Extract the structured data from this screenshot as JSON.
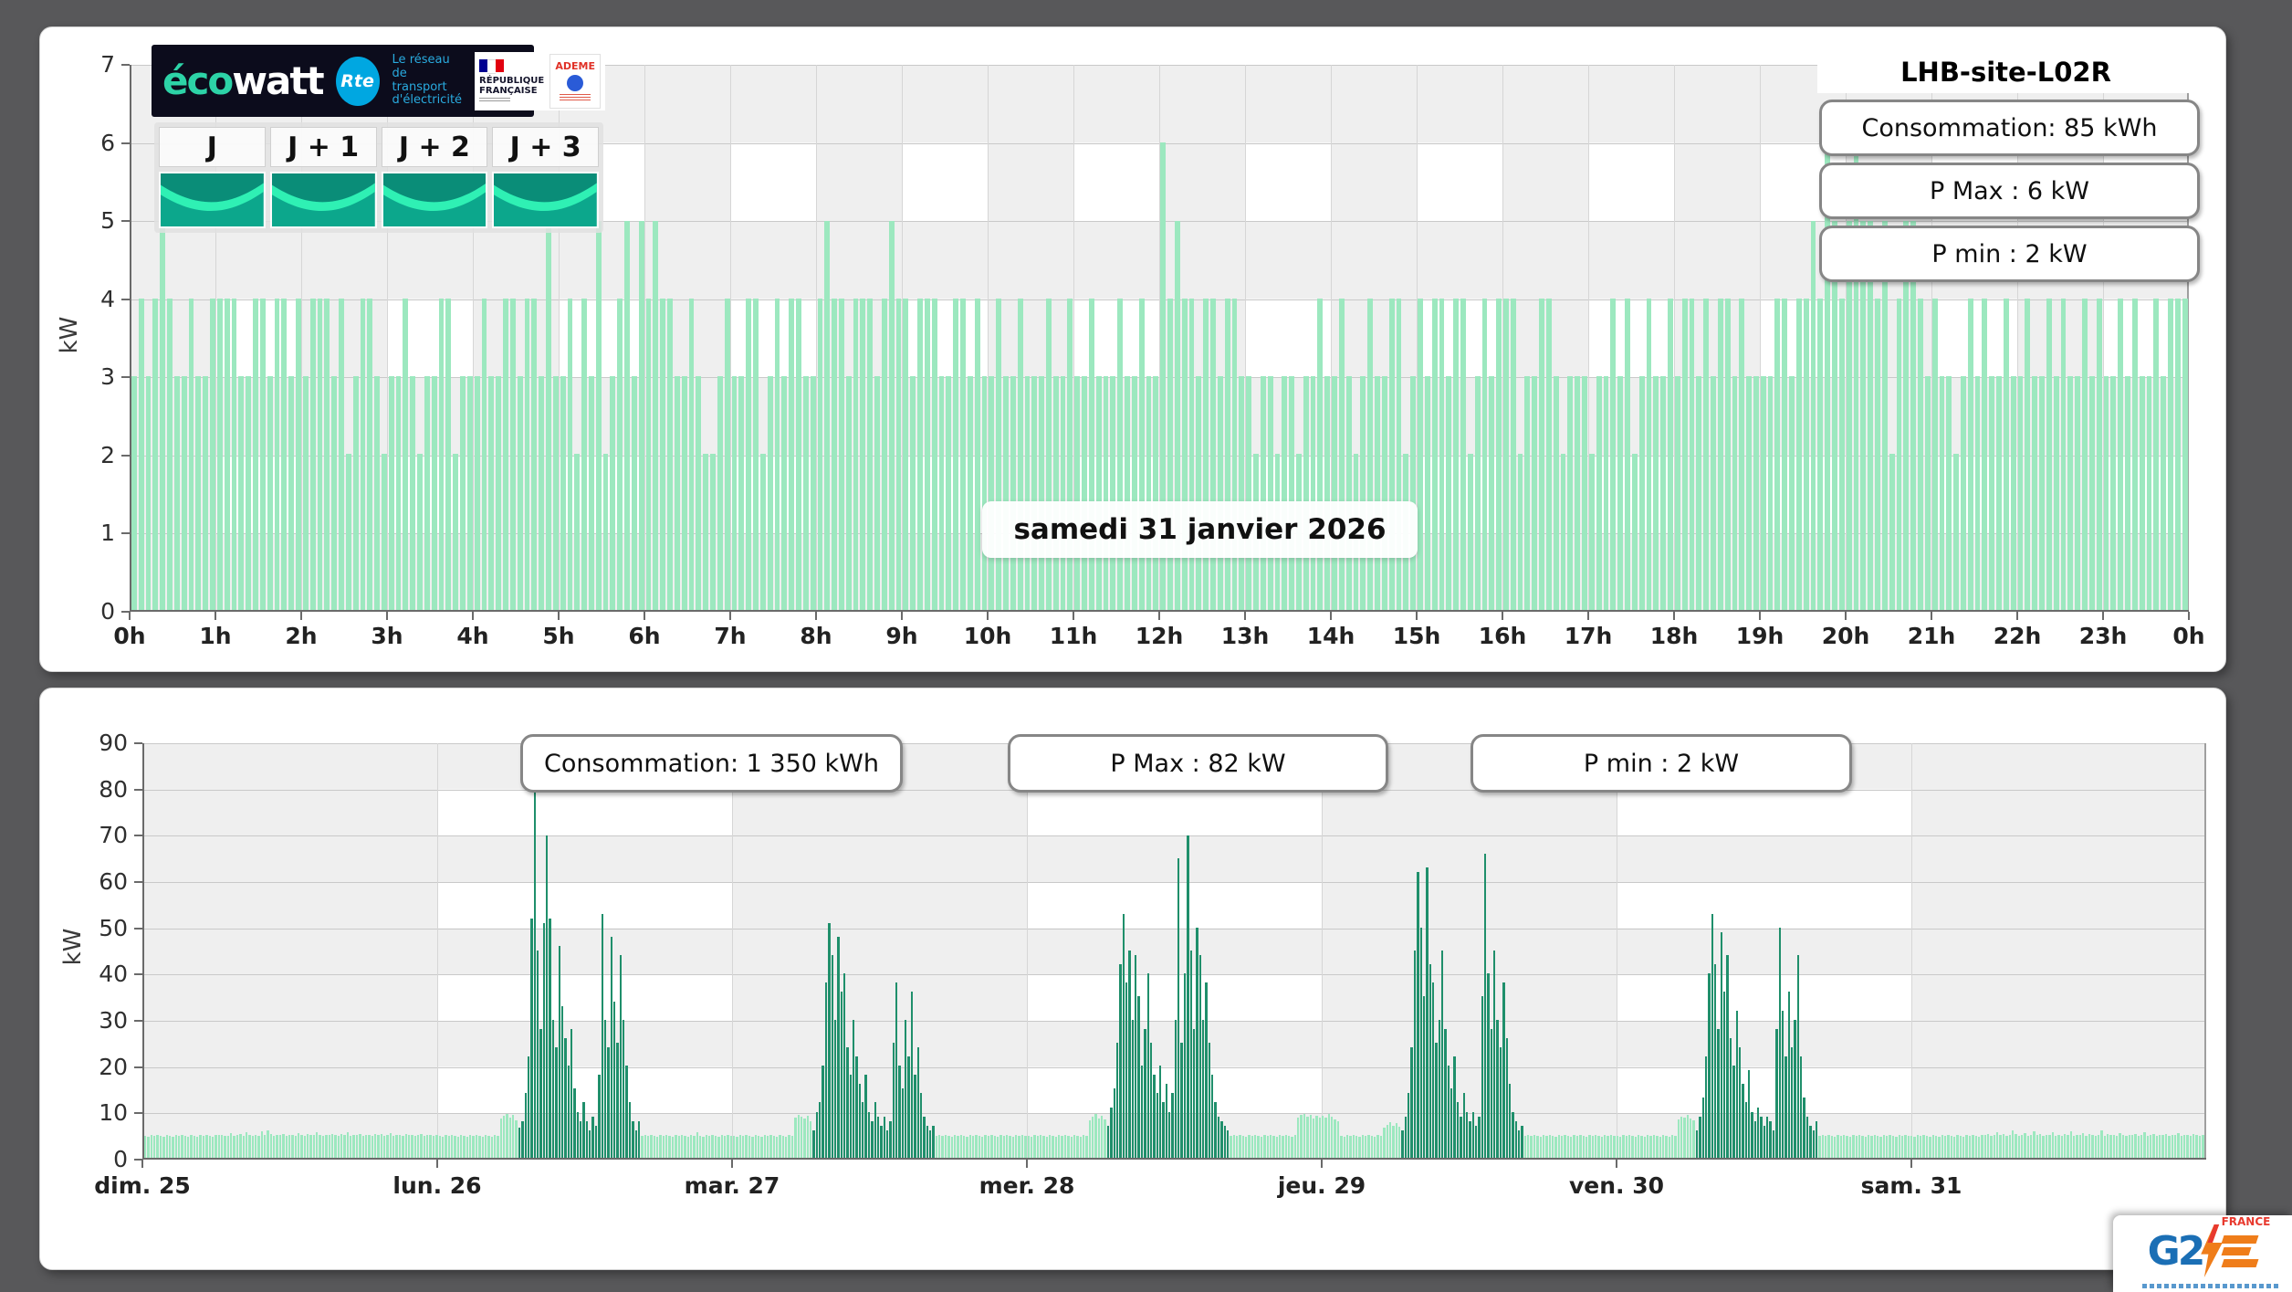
{
  "colors": {
    "page_bg": "#58585a",
    "panel_bg": "#ffffff",
    "band_gray": "#efefef",
    "bar_light": "#9ce8bf",
    "bar_dark": "#1f8f6b",
    "grid_line": "#c9c9c9",
    "axis_line": "#6a6a6a",
    "ecowatt_green": "#2dd3a7",
    "rte_blue": "#00a7e1",
    "banner_bg": "#0c0c1c",
    "gauge_teal": "#0ca78c",
    "gauge_dark": "#0a8d78",
    "gauge_bright": "#2ff0b4",
    "g2e_blue": "#1b6fb5",
    "g2e_orange": "#ef7d1a",
    "g2e_red": "#e8392e"
  },
  "header": {
    "brand_eco": "éco",
    "brand_watt": "watt",
    "rte": "Rte",
    "rte_tagline": "Le réseau\nde transport\nd'électricité",
    "republique": "RÉPUBLIQUE\nFRANÇAISE",
    "ademe": "ADEME"
  },
  "day_buttons": [
    "J",
    "J + 1",
    "J + 2",
    "J + 3"
  ],
  "footer_logo": {
    "g2": "G2",
    "france": "FRANCE"
  },
  "chart_data": [
    {
      "type": "bar",
      "title": "LHB-site-L02R",
      "y_title": "kW",
      "ylim": [
        0,
        7
      ],
      "y_ticks": [
        0,
        1,
        2,
        3,
        4,
        5,
        6,
        7
      ],
      "x_tick_labels": [
        "0h",
        "1h",
        "2h",
        "3h",
        "4h",
        "5h",
        "6h",
        "7h",
        "8h",
        "9h",
        "10h",
        "11h",
        "12h",
        "13h",
        "14h",
        "15h",
        "16h",
        "17h",
        "18h",
        "19h",
        "20h",
        "21h",
        "22h",
        "23h",
        "0h"
      ],
      "interval_minutes": 5,
      "grid": true,
      "legend_position": "none",
      "annotations": {
        "consumption": "Consommation: 85 kWh",
        "pmax": "P Max :  6 kW",
        "pmin": "P min : 2 kW",
        "date": "samedi 31 janvier 2026"
      },
      "values": [
        3,
        4,
        3,
        4,
        5,
        4,
        3,
        3,
        4,
        3,
        3,
        4,
        4,
        4,
        4,
        3,
        3,
        4,
        4,
        3,
        4,
        4,
        3,
        4,
        3,
        4,
        4,
        4,
        3,
        4,
        2,
        3,
        4,
        4,
        3,
        2,
        3,
        3,
        4,
        3,
        2,
        3,
        3,
        4,
        4,
        2,
        3,
        3,
        3,
        4,
        3,
        3,
        4,
        4,
        3,
        4,
        4,
        3,
        5,
        3,
        3,
        4,
        2,
        4,
        3,
        5,
        2,
        3,
        4,
        5,
        3,
        5,
        4,
        5,
        4,
        4,
        3,
        3,
        4,
        3,
        2,
        2,
        3,
        4,
        3,
        3,
        4,
        4,
        2,
        3,
        4,
        3,
        4,
        4,
        3,
        3,
        4,
        5,
        4,
        4,
        3,
        4,
        4,
        4,
        3,
        4,
        5,
        4,
        4,
        3,
        4,
        4,
        4,
        3,
        3,
        4,
        4,
        3,
        4,
        3,
        3,
        4,
        3,
        3,
        4,
        3,
        3,
        3,
        4,
        3,
        3,
        4,
        3,
        3,
        4,
        3,
        3,
        3,
        4,
        3,
        3,
        4,
        3,
        3,
        6,
        4,
        5,
        4,
        4,
        3,
        4,
        4,
        3,
        4,
        4,
        3,
        3,
        2,
        3,
        3,
        2,
        3,
        3,
        2,
        3,
        3,
        4,
        3,
        3,
        4,
        3,
        2,
        3,
        4,
        3,
        3,
        4,
        4,
        2,
        3,
        4,
        3,
        4,
        4,
        3,
        4,
        4,
        2,
        3,
        4,
        3,
        4,
        4,
        4,
        2,
        3,
        3,
        4,
        4,
        3,
        2,
        3,
        3,
        3,
        2,
        3,
        3,
        4,
        3,
        4,
        2,
        3,
        4,
        3,
        3,
        4,
        3,
        4,
        4,
        3,
        4,
        3,
        4,
        4,
        3,
        4,
        3,
        3,
        3,
        3,
        4,
        4,
        3,
        4,
        4,
        5,
        4,
        6,
        5,
        4,
        5,
        6,
        5,
        5,
        4,
        5,
        2,
        4,
        5,
        5,
        4,
        3,
        4,
        3,
        3,
        2,
        3,
        4,
        3,
        4,
        3,
        3,
        4,
        3,
        3,
        4,
        3,
        3,
        4,
        3,
        4,
        3,
        3,
        4,
        3,
        4,
        3,
        3,
        4,
        3,
        4,
        3,
        3,
        4,
        3,
        4,
        4,
        4
      ]
    },
    {
      "type": "bar",
      "y_title": "kW",
      "ylim": [
        0,
        90
      ],
      "y_ticks": [
        0,
        10,
        20,
        30,
        40,
        50,
        60,
        70,
        80,
        90
      ],
      "x_tick_labels": [
        "dim. 25",
        "lun. 26",
        "mar. 27",
        "mer. 28",
        "jeu. 29",
        "ven. 30",
        "sam. 31"
      ],
      "interval_minutes": 15,
      "grid": true,
      "legend_position": "none",
      "annotations": {
        "consumption": "Consommation: 1 350 kWh",
        "pmax": "P Max :  82 kW",
        "pmin": "P min : 2 kW"
      },
      "dark_ranges": [
        [
          122,
          162
        ],
        [
          218,
          258
        ],
        [
          314,
          354
        ],
        [
          410,
          450
        ],
        [
          506,
          546
        ]
      ],
      "values": [
        4.8,
        4.6,
        4.9,
        4.7,
        5.0,
        4.8,
        4.6,
        4.9,
        4.8,
        4.6,
        4.9,
        4.7,
        5.0,
        4.8,
        4.6,
        4.9,
        4.8,
        4.6,
        4.9,
        4.7,
        5.0,
        4.8,
        4.6,
        4.9,
        4.9,
        5.0,
        4.7,
        4.8,
        5.4,
        4.8,
        4.9,
        5.1,
        4.8,
        5.6,
        4.9,
        4.8,
        5.0,
        4.8,
        5.7,
        4.9,
        5.9,
        5.1,
        4.8,
        5.0,
        4.9,
        5.2,
        4.8,
        4.9,
        5.0,
        4.8,
        5.3,
        4.9,
        4.8,
        5.1,
        4.9,
        5.0,
        5.5,
        4.9,
        4.8,
        5.0,
        4.9,
        5.2,
        5.0,
        4.8,
        5.1,
        4.9,
        5.6,
        4.8,
        5.0,
        4.9,
        5.1,
        4.8,
        4.9,
        5.0,
        4.8,
        5.2,
        4.9,
        5.1,
        4.8,
        4.9,
        5.3,
        4.8,
        5.0,
        4.9,
        4.8,
        5.1,
        4.9,
        5.0,
        4.8,
        4.9,
        5.2,
        4.8,
        5.0,
        4.9,
        4.8,
        5.0,
        4.8,
        4.6,
        4.9,
        4.7,
        5.0,
        4.8,
        4.6,
        4.9,
        4.8,
        4.6,
        4.9,
        4.7,
        5.0,
        4.8,
        4.6,
        4.9,
        4.8,
        4.6,
        4.9,
        4.7,
        8.5,
        9.2,
        9.6,
        8.8,
        9.4,
        8.2,
        6.5,
        8,
        14,
        22,
        52,
        81,
        45,
        28,
        51,
        70,
        52,
        30,
        24,
        46,
        33,
        26,
        20,
        28,
        15,
        10,
        8,
        12,
        8,
        6,
        9,
        7,
        18,
        53,
        30,
        24,
        48,
        34,
        25,
        44,
        30,
        20,
        12,
        8,
        6,
        8,
        4.8,
        4.9,
        4.7,
        5.0,
        4.8,
        4.6,
        4.9,
        4.7,
        5.0,
        4.8,
        4.6,
        4.9,
        4.7,
        5.0,
        4.8,
        4.6,
        4.9,
        4.7,
        5.5,
        4.8,
        4.6,
        4.9,
        4.7,
        5.0,
        4.8,
        4.6,
        4.9,
        4.7,
        5.0,
        4.8,
        4.8,
        4.6,
        4.9,
        4.7,
        5.0,
        4.8,
        4.6,
        4.9,
        4.8,
        4.6,
        4.9,
        4.7,
        5.0,
        4.8,
        4.6,
        4.9,
        4.8,
        4.6,
        4.9,
        4.7,
        8.8,
        9.4,
        9.0,
        8.5,
        9.2,
        8.0,
        6,
        10,
        12,
        20,
        38,
        51,
        44,
        30,
        48,
        36,
        40,
        24,
        18,
        30,
        22,
        16,
        12,
        18,
        10,
        8,
        12,
        9,
        7,
        9,
        6,
        8,
        25,
        38,
        20,
        15,
        30,
        22,
        36,
        18,
        24,
        14,
        9,
        7,
        6,
        7,
        4.8,
        4.9,
        4.7,
        5.0,
        4.8,
        4.6,
        4.9,
        4.7,
        5.0,
        4.8,
        4.6,
        4.9,
        4.7,
        5.0,
        4.8,
        4.6,
        4.9,
        4.7,
        5.0,
        4.8,
        4.6,
        4.9,
        4.7,
        5.0,
        4.8,
        4.6,
        4.9,
        4.7,
        5.0,
        4.8,
        4.8,
        4.6,
        4.9,
        4.7,
        5.0,
        4.8,
        4.6,
        4.9,
        4.8,
        4.6,
        4.9,
        4.7,
        5.0,
        4.8,
        4.6,
        4.9,
        4.8,
        4.6,
        4.9,
        4.7,
        8.2,
        9.0,
        9.5,
        8.6,
        9.1,
        8.4,
        7,
        11,
        15,
        25,
        42,
        53,
        38,
        45,
        30,
        44,
        35,
        20,
        28,
        40,
        25,
        18,
        14,
        20,
        12,
        16,
        10,
        14,
        30,
        65,
        25,
        40,
        70,
        45,
        28,
        50,
        44,
        30,
        38,
        25,
        18,
        12,
        9,
        8,
        7,
        6,
        4.8,
        4.9,
        4.7,
        5.0,
        4.8,
        4.6,
        4.9,
        4.7,
        5.0,
        4.8,
        4.6,
        4.9,
        4.7,
        5.0,
        4.8,
        4.6,
        4.9,
        4.7,
        5.0,
        4.8,
        4.6,
        4.9,
        8.8,
        9.3,
        9.6,
        9.0,
        9.4,
        8.6,
        9.2,
        8.8,
        9.2,
        8.8,
        9.5,
        9.0,
        8.4,
        8.0,
        4.8,
        4.6,
        4.9,
        4.7,
        5.0,
        4.8,
        4.6,
        4.9,
        4.7,
        5.0,
        4.8,
        4.6,
        4.9,
        4.7,
        6.5,
        7.2,
        7.8,
        7.0,
        7.5,
        6.8,
        6,
        9,
        14,
        24,
        45,
        62,
        50,
        35,
        63,
        42,
        38,
        25,
        30,
        45,
        28,
        20,
        15,
        22,
        12,
        9,
        14,
        10,
        8,
        10,
        7,
        9,
        35,
        66,
        40,
        28,
        45,
        30,
        24,
        38,
        26,
        16,
        10,
        8,
        6,
        7,
        4.8,
        4.9,
        4.7,
        5.0,
        4.8,
        4.6,
        4.9,
        4.7,
        5.0,
        4.8,
        4.6,
        4.9,
        4.7,
        5.0,
        4.8,
        4.6,
        4.9,
        4.7,
        5.0,
        4.8,
        4.6,
        4.9,
        4.7,
        5.0,
        4.8,
        4.6,
        4.9,
        4.7,
        5.0,
        4.8,
        4.8,
        4.6,
        4.9,
        4.7,
        5.0,
        4.8,
        4.6,
        4.9,
        4.8,
        4.6,
        4.9,
        4.7,
        5.0,
        4.8,
        4.6,
        4.9,
        4.8,
        4.6,
        4.9,
        4.7,
        8.4,
        9.0,
        8.7,
        9.3,
        8.6,
        8.1,
        6,
        9,
        13,
        22,
        40,
        53,
        42,
        28,
        49,
        36,
        44,
        26,
        20,
        32,
        24,
        16,
        12,
        19,
        10,
        8,
        11,
        9,
        7,
        9,
        8,
        6,
        28,
        50,
        32,
        22,
        36,
        24,
        30,
        44,
        22,
        13,
        9,
        7,
        6,
        8,
        4.8,
        4.9,
        4.7,
        5.0,
        4.8,
        4.6,
        4.9,
        4.7,
        5.0,
        4.8,
        4.6,
        4.9,
        4.7,
        5.0,
        4.8,
        4.6,
        4.9,
        4.7,
        5.0,
        4.8,
        4.6,
        4.9,
        4.7,
        5.0,
        4.8,
        4.6,
        4.9,
        4.7,
        5.0,
        4.8,
        4.8,
        4.6,
        4.9,
        4.7,
        5.0,
        4.8,
        4.6,
        4.9,
        4.8,
        4.6,
        4.9,
        4.7,
        5.0,
        4.8,
        4.6,
        4.9,
        4.8,
        4.6,
        4.9,
        4.7,
        5.0,
        4.8,
        4.6,
        4.9,
        4.9,
        5.1,
        4.8,
        5.0,
        5.6,
        4.9,
        5.2,
        4.8,
        5.0,
        6.0,
        5.1,
        4.8,
        4.9,
        5.3,
        4.8,
        5.0,
        5.8,
        4.9,
        5.1,
        4.8,
        5.0,
        4.9,
        5.5,
        4.8,
        5.0,
        4.8,
        5.2,
        4.9,
        5.7,
        4.8,
        5.0,
        4.9,
        5.4,
        4.8,
        5.1,
        4.9,
        4.8,
        5.0,
        5.9,
        4.8,
        5.1,
        4.9,
        5.0,
        4.8,
        5.3,
        4.9,
        4.8,
        5.0,
        4.9,
        5.1,
        4.8,
        5.0,
        5.5,
        4.8,
        4.9,
        5.2,
        4.8,
        5.0,
        4.9,
        5.1,
        4.8,
        5.0,
        4.9,
        5.3,
        4.8,
        5.0,
        4.9,
        4.8,
        5.1,
        4.9,
        4.8,
        5.0
      ]
    }
  ]
}
